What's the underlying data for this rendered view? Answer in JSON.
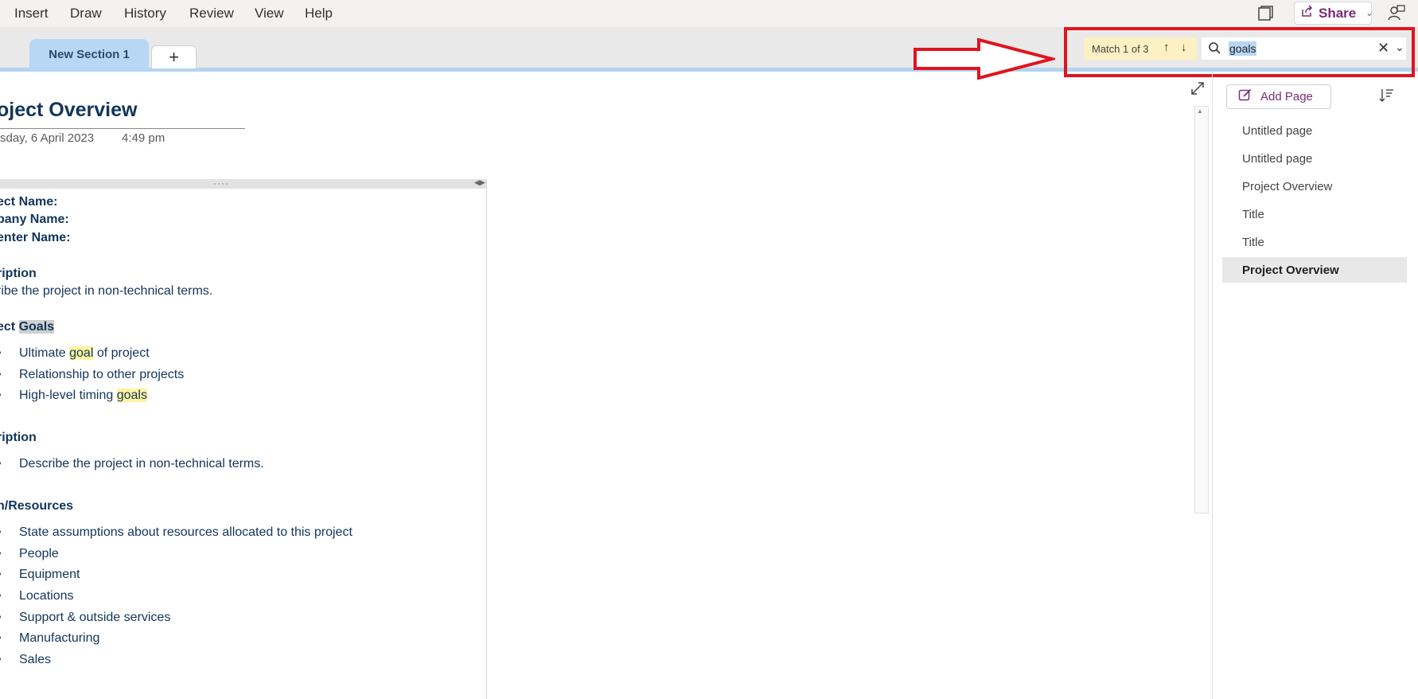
{
  "menu": {
    "items": [
      "Insert",
      "Draw",
      "History",
      "Review",
      "View",
      "Help"
    ],
    "share_label": "Share"
  },
  "sections": {
    "active_tab": "New Section 1",
    "add_tab_label": "+"
  },
  "find": {
    "match_text": "Match 1 of 3",
    "query": "goals"
  },
  "page": {
    "title": "oject Overview",
    "date": "sday, 6 April 2023",
    "time": "4:49 pm",
    "field_labels": [
      "ect Name:",
      "pany Name:",
      "enter Name:"
    ],
    "desc_heading": "ription",
    "desc_text": "ribe the project in non-technical terms.",
    "goals_heading_prefix": "ect ",
    "goals_heading_match": "Goals",
    "goals_bullets": {
      "b1_pre": "Ultimate ",
      "b1_match": "goal",
      "b1_post": " of project",
      "b2": "Relationship to other projects",
      "b3_pre": "High-level timing ",
      "b3_match": "goals"
    },
    "desc2_heading": "ription",
    "desc2_bullet": "Describe the project in non-technical terms.",
    "resources_heading": "n/Resources",
    "resources_bullets": [
      "State assumptions about resources allocated to this project",
      "People",
      "Equipment",
      "Locations",
      "Support & outside services",
      "Manufacturing",
      "Sales"
    ]
  },
  "pages_pane": {
    "add_page_label": "Add Page",
    "pages": [
      "Untitled page",
      "Untitled page",
      "Project Overview",
      "Title",
      "Title",
      "Project Overview"
    ],
    "active_index": 5
  },
  "colors": {
    "annotation": "#e0141e",
    "highlight": "#fff3a0",
    "accent": "#7a2a7a"
  }
}
